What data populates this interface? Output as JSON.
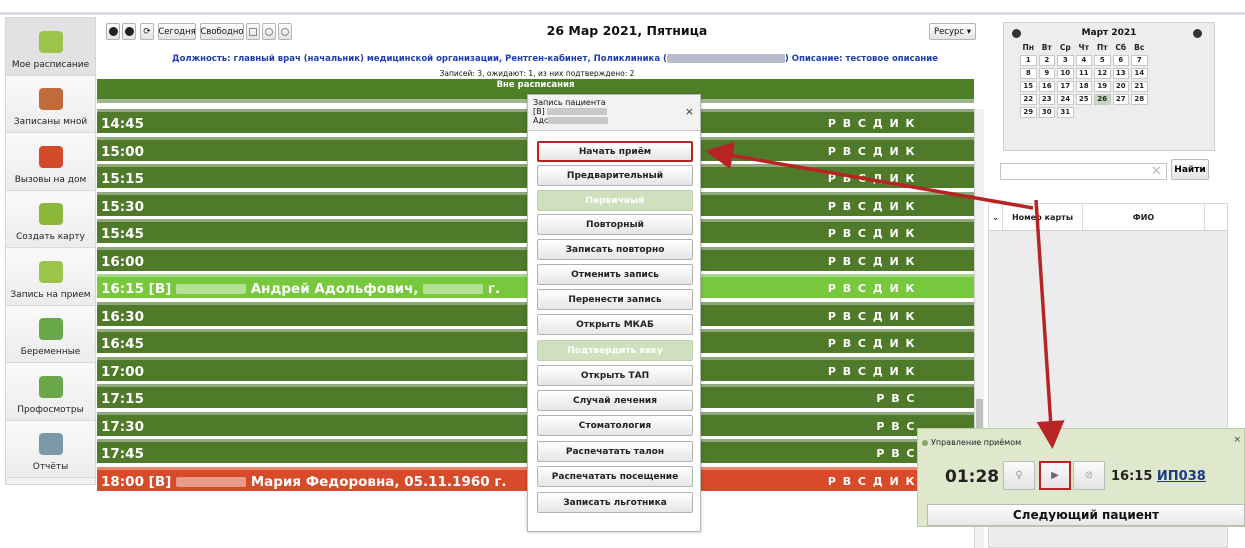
{
  "sidebar": {
    "items": [
      {
        "label": "Мое расписание",
        "icon": "calendar-check-icon"
      },
      {
        "label": "Записаны мной",
        "icon": "user-arrow-icon"
      },
      {
        "label": "Вызовы на дом",
        "icon": "user-house-icon"
      },
      {
        "label": "Создать карту",
        "icon": "card-check-icon"
      },
      {
        "label": "Запись на прием",
        "icon": "calendar-check-icon"
      },
      {
        "label": "Беременные",
        "icon": "pregnant-icon"
      },
      {
        "label": "Профосмотры",
        "icon": "user-icon"
      },
      {
        "label": "Отчёты",
        "icon": "report-icon"
      }
    ]
  },
  "toolbar": {
    "today_label": "Сегодня",
    "free_label": "Свободно",
    "date_title": "26 Мар 2021, Пятница",
    "resource_label": "Ресурс ▾"
  },
  "info": {
    "position_text": "Должность: главный врач (начальник) медицинской организации, Рентген-кабинет, Поликлиника (",
    "description_text": ") Описание: тестовое описание",
    "stats": "Записей: 3, ожидают: 1, из них подтверждено: 2",
    "out_of_schedule": "Вне расписания"
  },
  "slots": [
    {
      "time": "14:45",
      "codes": "Р В С Д И К"
    },
    {
      "time": "15:00",
      "codes": "Р В С Д И К"
    },
    {
      "time": "15:15",
      "codes": "Р В С Д И К"
    },
    {
      "time": "15:30",
      "codes": "Р В С Д И К"
    },
    {
      "time": "15:45",
      "codes": "Р В С Д И К"
    },
    {
      "time": "16:00",
      "codes": "Р В С Д И К"
    },
    {
      "time": "16:15 [В]",
      "name": "Андрей Адольфович,",
      "suffix": " г.",
      "codes": "Р В С Д И К",
      "state": "selected"
    },
    {
      "time": "16:30",
      "codes": "Р В С Д И К"
    },
    {
      "time": "16:45",
      "codes": "Р В С Д И К"
    },
    {
      "time": "17:00",
      "codes": "Р В С Д И К"
    },
    {
      "time": "17:15",
      "codes": "Р В С"
    },
    {
      "time": "17:30",
      "codes": "Р В С"
    },
    {
      "time": "17:45",
      "codes": "Р В С"
    },
    {
      "time": "18:00 [В]",
      "name": "Мария Федоровна, 05.11.1960 г.",
      "codes": "Р В С Д И К",
      "state": "red"
    }
  ],
  "popup": {
    "title": "Запись пациента",
    "line2": "[В]",
    "line3": "Адс",
    "buttons": [
      {
        "label": "Начать приём",
        "state": "highlight"
      },
      {
        "label": "Предварительный"
      },
      {
        "label": "Первичный",
        "state": "disabled"
      },
      {
        "label": "Повторный"
      },
      {
        "label": "Записать повторно"
      },
      {
        "label": "Отменить запись"
      },
      {
        "label": "Перенести запись"
      },
      {
        "label": "Открыть МКАБ"
      },
      {
        "label": "Подтвердить явку",
        "state": "disabled"
      },
      {
        "label": "Открыть ТАП"
      },
      {
        "label": "Случай лечения"
      },
      {
        "label": "Стоматология"
      },
      {
        "label": "Распечатать талон"
      },
      {
        "label": "Распечатать посещение"
      },
      {
        "label": "Записать льготника"
      }
    ]
  },
  "calendar": {
    "month": "Март 2021",
    "dow": [
      "Пн",
      "Вт",
      "Ср",
      "Чт",
      "Пт",
      "Сб",
      "Вс"
    ],
    "days": [
      "1",
      "2",
      "3",
      "4",
      "5",
      "6",
      "7",
      "8",
      "9",
      "10",
      "11",
      "12",
      "13",
      "14",
      "15",
      "16",
      "17",
      "18",
      "19",
      "20",
      "21",
      "22",
      "23",
      "24",
      "25",
      "26",
      "27",
      "28",
      "29",
      "30",
      "31"
    ],
    "today": "26"
  },
  "search": {
    "button_label": "Найти",
    "value": ""
  },
  "table": {
    "col_card": "Номер карты",
    "col_name": "ФИО"
  },
  "reception": {
    "title": "Управление приёмом",
    "timer": "01:28",
    "slot_time": "16:15",
    "slot_code": "ИП038",
    "next_label": "Следующий пациент"
  },
  "colors": {
    "slot_green": "#4f7a29",
    "slot_selected": "#78c83e",
    "slot_red": "#d84a2a",
    "annotation": "#b82323"
  }
}
